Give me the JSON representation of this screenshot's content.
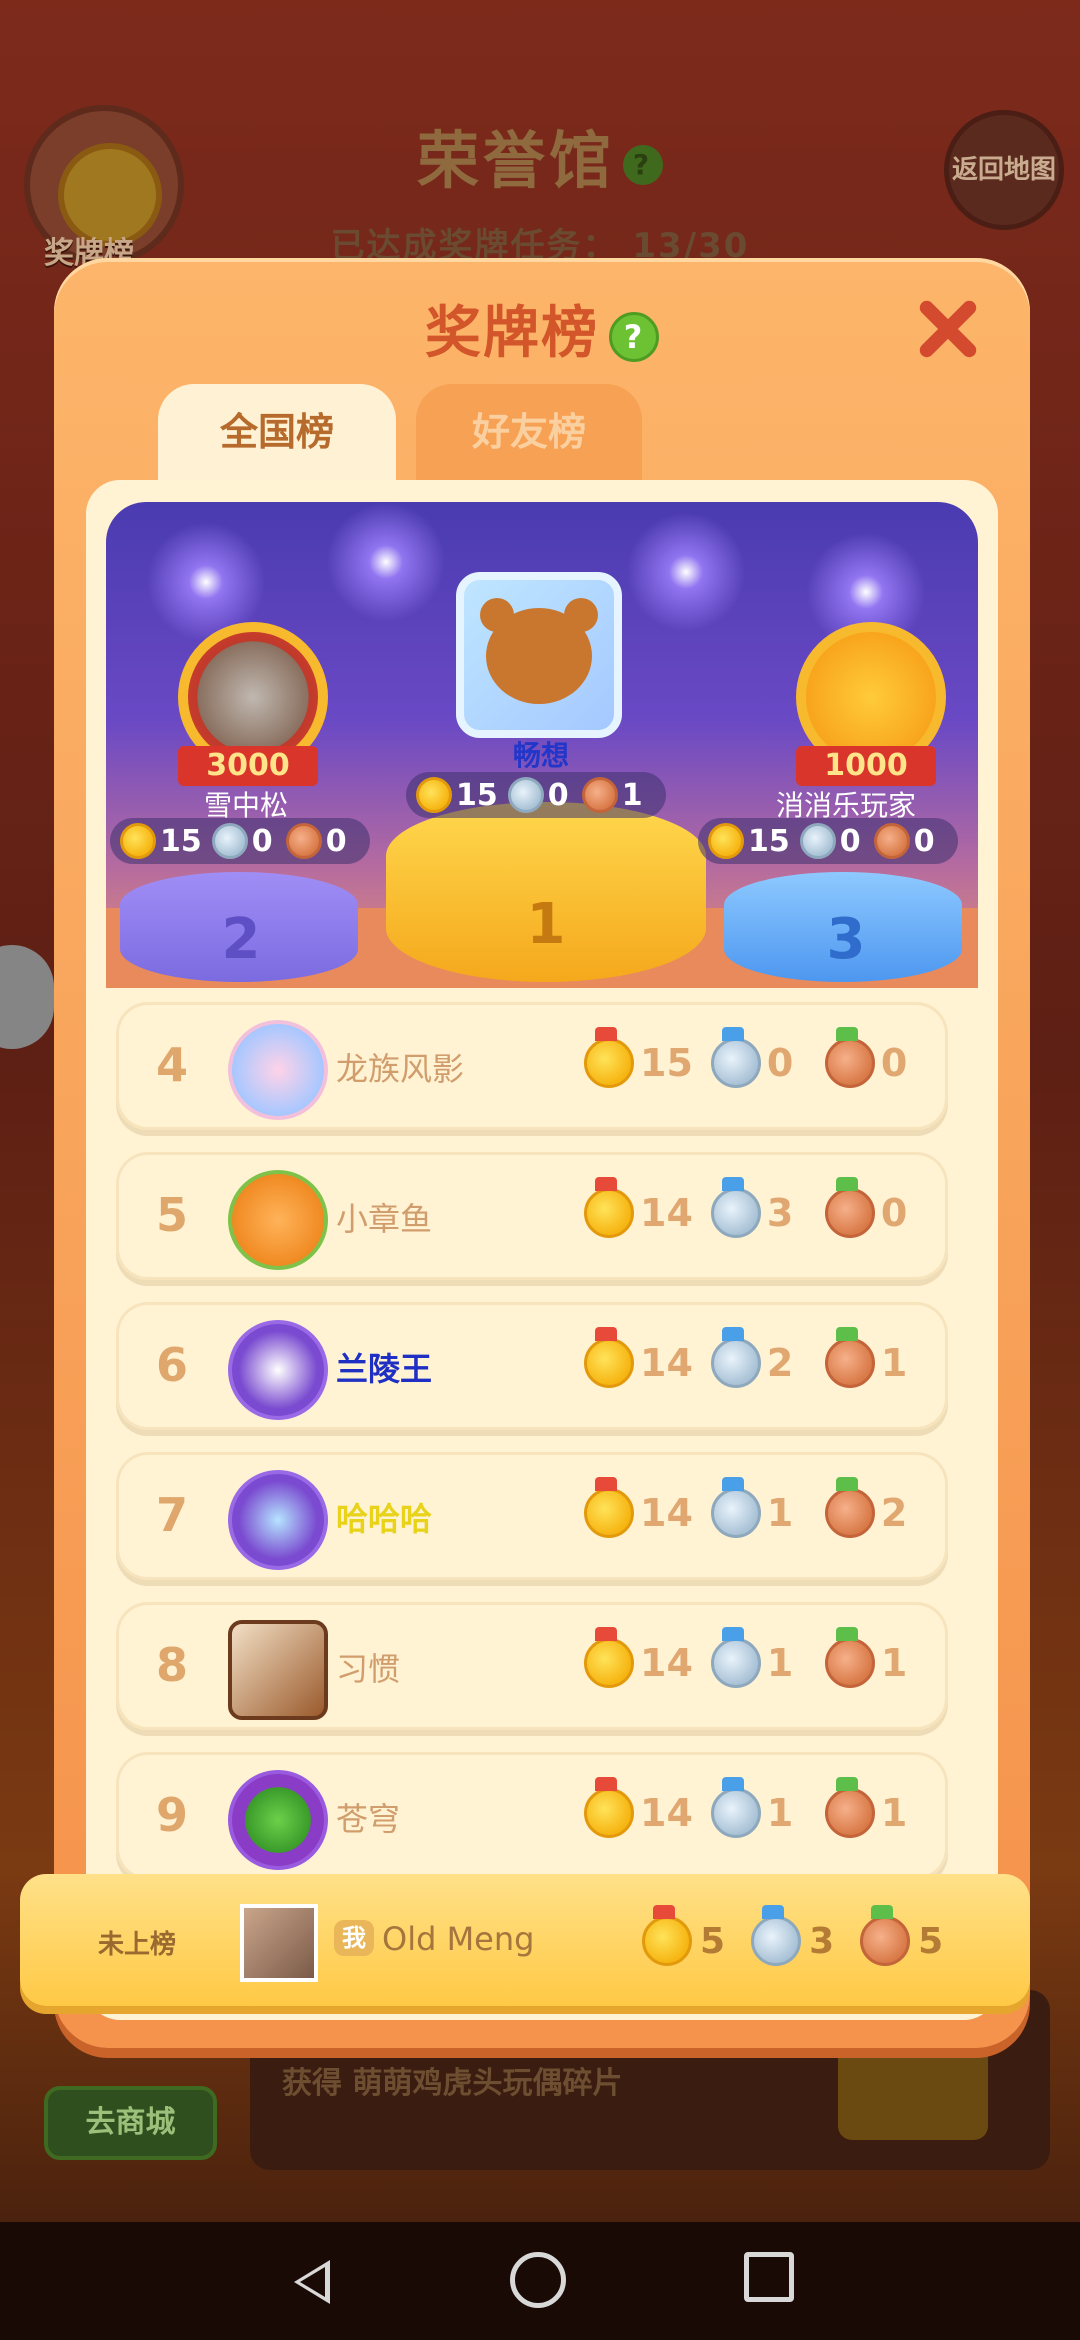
{
  "background": {
    "medal_button_label": "奖牌榜",
    "title": "荣誉馆",
    "progress_label": "已达成奖牌任务：",
    "progress_value": "13/30",
    "back_map_label": "返回地图",
    "reward_text": "获得 萌萌鸡虎头玩偶碎片",
    "store_button_label": "去商城"
  },
  "modal": {
    "title": "奖牌榜",
    "help_icon": "?",
    "tabs": [
      {
        "label": "全国榜",
        "active": true
      },
      {
        "label": "好友榜",
        "active": false
      }
    ]
  },
  "podium": {
    "first": {
      "rank": "1",
      "name": "畅想",
      "gold": "15",
      "silver": "0",
      "bronze": "1"
    },
    "second": {
      "rank": "2",
      "name": "雪中松",
      "badge": "3000",
      "gold": "15",
      "silver": "0",
      "bronze": "0"
    },
    "third": {
      "rank": "3",
      "name": "消消乐玩家",
      "badge": "1000",
      "gold": "15",
      "silver": "0",
      "bronze": "0"
    }
  },
  "rows": [
    {
      "rank": "4",
      "name": "龙族风影",
      "gold": "15",
      "silver": "0",
      "bronze": "0",
      "name_color": "#d19d6c"
    },
    {
      "rank": "5",
      "name": "小章鱼",
      "gold": "14",
      "silver": "3",
      "bronze": "0",
      "name_color": "#d19d6c"
    },
    {
      "rank": "6",
      "name": "兰陵王",
      "gold": "14",
      "silver": "2",
      "bronze": "1",
      "name_color": "#1f2fc4"
    },
    {
      "rank": "7",
      "name": "哈哈哈",
      "gold": "14",
      "silver": "1",
      "bronze": "2",
      "name_color": "#e8d31a"
    },
    {
      "rank": "8",
      "name": "习惯",
      "gold": "14",
      "silver": "1",
      "bronze": "1",
      "name_color": "#d19d6c"
    },
    {
      "rank": "9",
      "name": "苍穹",
      "gold": "14",
      "silver": "1",
      "bronze": "1",
      "name_color": "#d19d6c"
    }
  ],
  "me": {
    "status": "未上榜",
    "tag": "我",
    "name": "Old Meng",
    "gold": "5",
    "silver": "3",
    "bronze": "5"
  },
  "colors": {
    "accent": "#d3552a",
    "modal_bg": "#f5924b",
    "board_bg": "#fff3d4",
    "gold": "#f6b512",
    "silver": "#a9c2d6",
    "bronze": "#d97a48"
  }
}
